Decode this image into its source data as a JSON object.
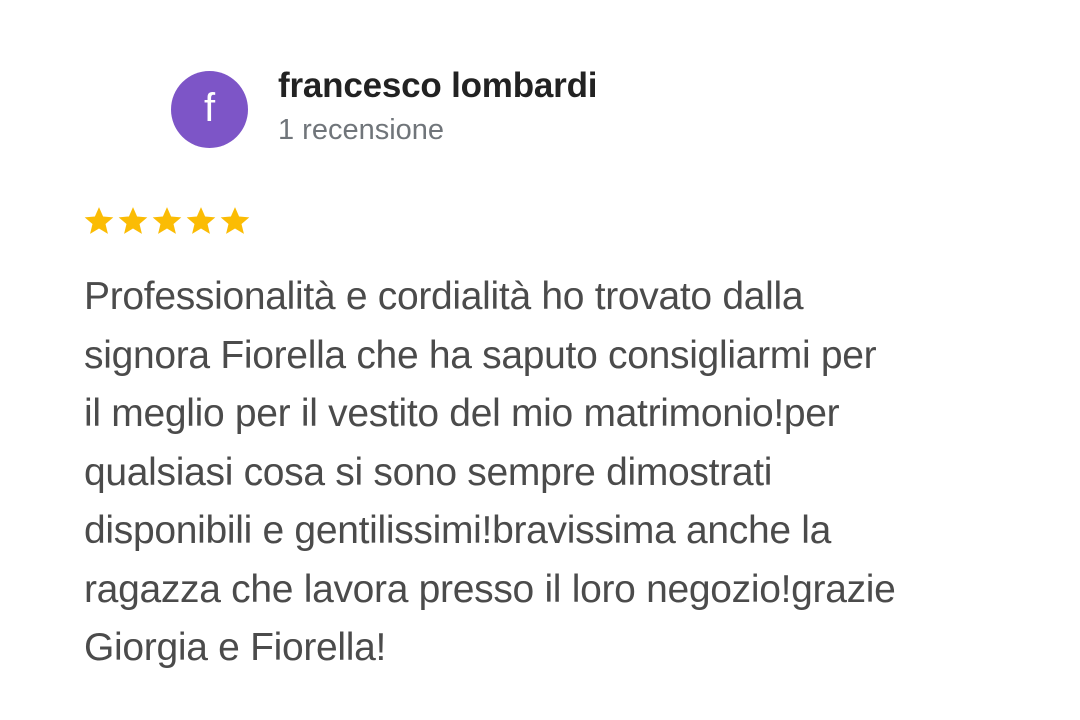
{
  "reviewer": {
    "avatar_initial": "f",
    "avatar_color": "#7d55c7",
    "name": "francesco lombardi",
    "review_count": "1 recensione"
  },
  "rating": {
    "stars": 5,
    "max_stars": 5,
    "star_color": "#fbbc04",
    "icon": "star-icon"
  },
  "review": {
    "lines": [
      "Professionalità e cordialità ho trovato dalla",
      "signora Fiorella che ha saputo consigliarmi per",
      "il meglio per il vestito del mio matrimonio!per",
      "qualsiasi cosa si sono sempre dimostrati",
      "disponibili e gentilissimi!bravissima anche la",
      "ragazza che lavora presso il loro negozio!grazie",
      "Giorgia e Fiorella!"
    ]
  }
}
